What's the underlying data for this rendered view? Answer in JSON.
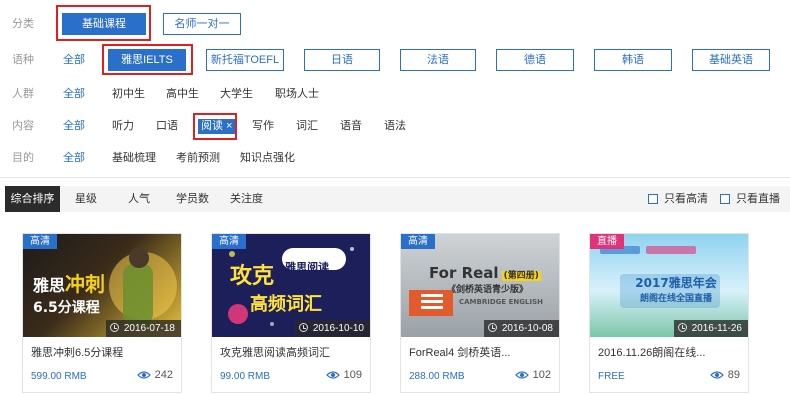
{
  "filters": {
    "category": {
      "label": "分类",
      "options": [
        "基础课程",
        "名师一对一"
      ]
    },
    "language": {
      "label": "语种",
      "all": "全部",
      "options": [
        "雅思IELTS",
        "新托福TOEFL",
        "日语",
        "法语",
        "德语",
        "韩语",
        "基础英语"
      ]
    },
    "audience": {
      "label": "人群",
      "all": "全部",
      "options": [
        "初中生",
        "高中生",
        "大学生",
        "职场人士"
      ]
    },
    "content": {
      "label": "内容",
      "all": "全部",
      "options": [
        "听力",
        "口语",
        "阅读 ×",
        "写作",
        "词汇",
        "语音",
        "语法"
      ]
    },
    "purpose": {
      "label": "目的",
      "all": "全部",
      "options": [
        "基础梳理",
        "考前预测",
        "知识点强化"
      ]
    }
  },
  "sortbar": {
    "items": [
      "综合排序",
      "星级",
      "人气",
      "学员数",
      "关注度"
    ],
    "checkboxes": [
      "只看高清",
      "只看直播"
    ]
  },
  "courses": [
    {
      "badge": "高清",
      "badge_color": "#2a6fc9",
      "date": "2016-07-18",
      "title": "雅思冲刺6.5分课程",
      "price": "599.00 RMB",
      "views": "242",
      "art": [
        "雅思",
        "冲刺",
        "6.5分课程"
      ]
    },
    {
      "badge": "高清",
      "badge_color": "#2a6fc9",
      "date": "2016-10-10",
      "title": "攻克雅思阅读高频词汇",
      "price": "99.00 RMB",
      "views": "109",
      "art": [
        "攻克",
        "雅思阅读",
        "高频词汇"
      ]
    },
    {
      "badge": "高清",
      "badge_color": "#2a6fc9",
      "date": "2016-10-08",
      "title": "ForReal4 剑桥英语...",
      "price": "288.00 RMB",
      "views": "102",
      "art": [
        "For Real",
        "(第四册)",
        "《剑桥英语青少版》",
        "CAMBRIDGE ENGLISH"
      ]
    },
    {
      "badge": "直播",
      "badge_color": "#e0337a",
      "date": "2016-11-26",
      "title": "2016.11.26朗阁在线...",
      "price": "FREE",
      "views": "89",
      "art": [
        "2017雅思年会",
        "朗阁在线全国直播"
      ]
    }
  ],
  "colors": {
    "accent": "#2a6fc9",
    "highlight": "#e02020",
    "live": "#e0337a"
  }
}
